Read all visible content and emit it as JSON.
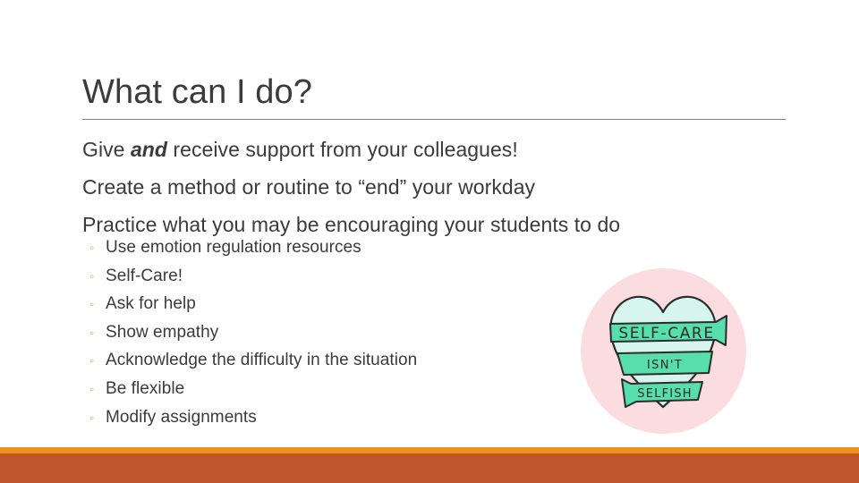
{
  "slide": {
    "title": "What can I do?",
    "body_lines": [
      {
        "pre": "Give ",
        "emphasis": "and",
        "post": " receive support from your colleagues!"
      },
      {
        "pre": "Create a method or routine to “end” your workday",
        "emphasis": "",
        "post": ""
      },
      {
        "pre": "Practice what you may be encouraging your students to do",
        "emphasis": "",
        "post": ""
      }
    ],
    "body_line_1_pre": "Give ",
    "body_line_1_em": "and",
    "body_line_1_post": " receive support from your colleagues!",
    "body_line_2": "Create a method or routine to “end” your workday",
    "body_line_3": "Practice what you may be encouraging your students to do",
    "sub_bullets": [
      {
        "marker": "◦",
        "label": "Use emotion regulation resources"
      },
      {
        "marker": "◦",
        "label": "Self-Care!"
      },
      {
        "marker": "◦",
        "label": "Ask for help"
      },
      {
        "marker": "◦",
        "label": "Show empathy"
      },
      {
        "marker": "◦",
        "label": "Acknowledge the difficulty in the situation"
      },
      {
        "marker": "◦",
        "label": "Be flexible"
      },
      {
        "marker": "◦",
        "label": "Modify assignments"
      }
    ],
    "artwork": {
      "name": "self-care-heart-illustration",
      "banner_line_1": "SELF-CARE",
      "banner_line_2": "ISN'T",
      "banner_line_3": "SELFISH",
      "circle_color": "#fbdce1",
      "heart_light_color": "#d6f5ec",
      "heart_mint_color": "#57ddae",
      "outline_color": "#2b2b2b"
    },
    "colors": {
      "text": "#3b3b3b",
      "rule": "#7f7f7f",
      "bullet": "#c3b383",
      "band_orange": "#ef8f20",
      "band_terracotta": "#c0562b",
      "background": "#ffffff"
    }
  }
}
